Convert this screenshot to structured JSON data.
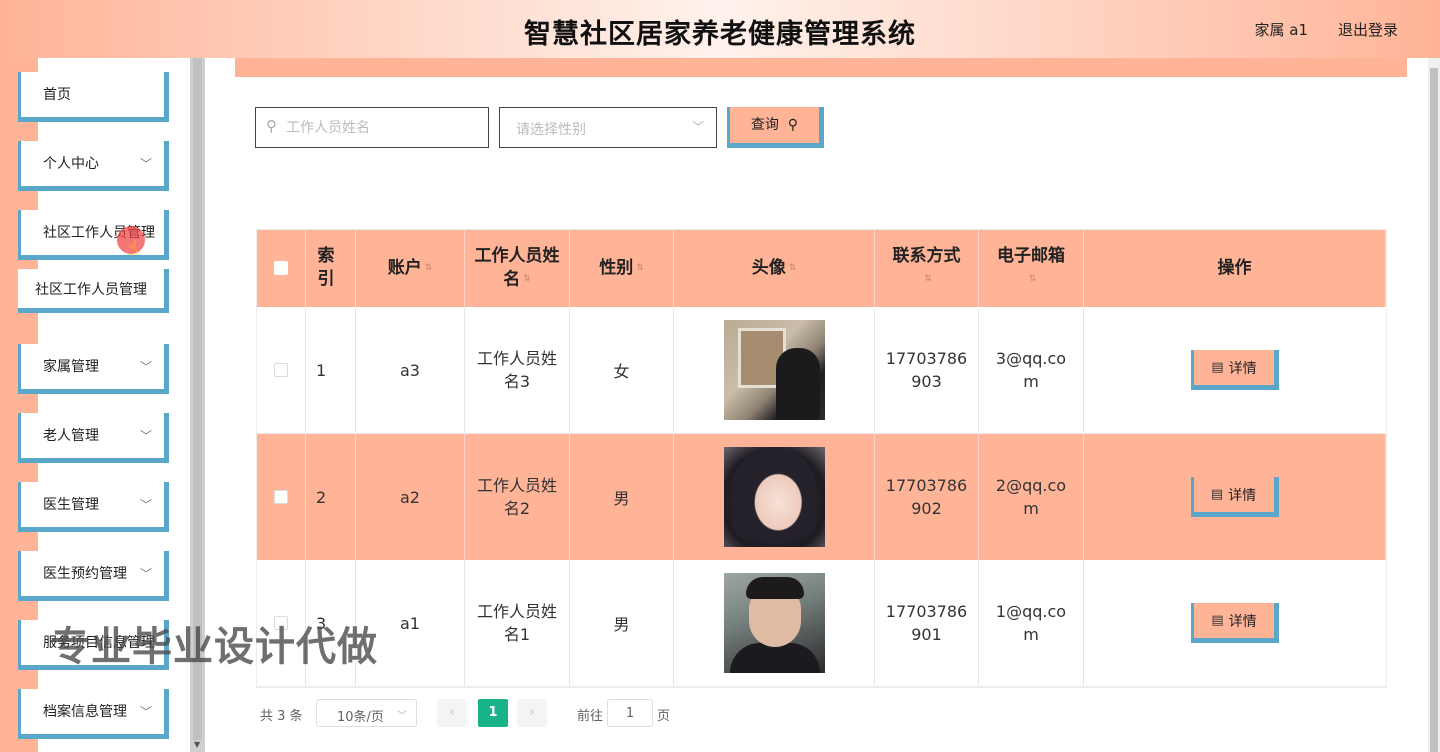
{
  "header": {
    "title": "智慧社区居家养老健康管理系统",
    "user": "家属 a1",
    "logout": "退出登录"
  },
  "sidebar": {
    "items": [
      {
        "label": "首页",
        "has_children": false
      },
      {
        "label": "个人中心",
        "has_children": true
      },
      {
        "label": "社区工作人员管理",
        "has_children": true,
        "expanded": true
      },
      {
        "label": "家属管理",
        "has_children": true
      },
      {
        "label": "老人管理",
        "has_children": true
      },
      {
        "label": "医生管理",
        "has_children": true
      },
      {
        "label": "医生预约管理",
        "has_children": true
      },
      {
        "label": "服务项目信息管理",
        "has_children": true
      },
      {
        "label": "档案信息管理",
        "has_children": true
      }
    ],
    "sub_items": [
      {
        "label": "社区工作人员管理"
      }
    ],
    "chevron": "chevron-down-icon"
  },
  "search": {
    "name_placeholder": "工作人员姓名",
    "name_value": "",
    "gender_placeholder": "请选择性别",
    "query_label": "查询"
  },
  "table": {
    "columns": [
      "",
      "索引",
      "账户",
      "工作人员姓名",
      "性别",
      "头像",
      "联系方式",
      "电子邮箱",
      "操作"
    ],
    "rows": [
      {
        "index": "1",
        "account": "a3",
        "name": "工作人员姓名3",
        "gender": "女",
        "avatar": "photo-person-gallery",
        "phone": "17703786903",
        "email": "3@qq.com",
        "action": "详情"
      },
      {
        "index": "2",
        "account": "a2",
        "name": "工作人员姓名2",
        "gender": "男",
        "avatar": "photo-girl-bob-hair",
        "phone": "17703786902",
        "email": "2@qq.com",
        "action": "详情"
      },
      {
        "index": "3",
        "account": "a1",
        "name": "工作人员姓名1",
        "gender": "男",
        "avatar": "photo-young-man",
        "phone": "17703786901",
        "email": "1@qq.com",
        "action": "详情"
      }
    ]
  },
  "pagination": {
    "total": "共 3 条",
    "page_size": "10条/页",
    "current_page": "1",
    "goto_label": "前往",
    "goto_value": "1",
    "page_unit": "页"
  },
  "watermark": "专业毕业设计代做",
  "colors": {
    "accent": "#ffb498",
    "border_blue": "#5ba7c9",
    "page_active": "#19b38a"
  }
}
